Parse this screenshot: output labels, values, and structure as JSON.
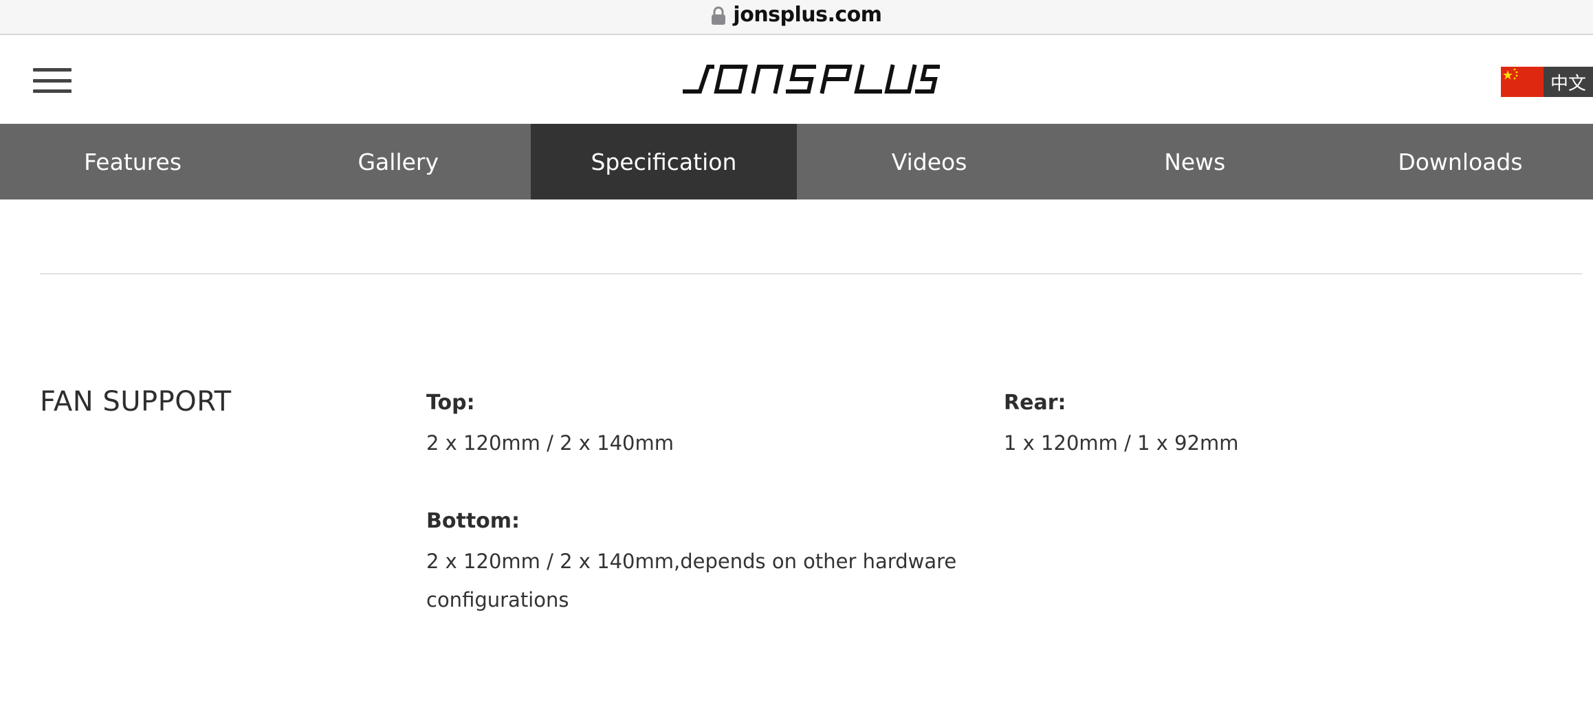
{
  "browser": {
    "url": "jonsplus.com",
    "lock_icon": "lock-icon"
  },
  "header": {
    "menu_icon": "hamburger-menu-icon",
    "logo_text": "JONSPLUS",
    "language": {
      "flag_icon": "china-flag-icon",
      "label": "中文"
    }
  },
  "nav": {
    "tabs": [
      {
        "label": "Features"
      },
      {
        "label": "Gallery"
      },
      {
        "label": "Specification",
        "active": true
      },
      {
        "label": "Videos"
      },
      {
        "label": "News"
      },
      {
        "label": "Downloads"
      }
    ]
  },
  "spec": {
    "section_title": "FAN SUPPORT",
    "top": {
      "label": "Top:",
      "value": "2 x 120mm / 2 x 140mm"
    },
    "rear": {
      "label": "Rear:",
      "value": "1 x 120mm / 1 x 92mm"
    },
    "bottom": {
      "label": "Bottom:",
      "value_line1": "2 x 120mm / 2 x 140mm,depends on other hardware",
      "value_line2": "configurations"
    }
  },
  "colors": {
    "nav_bg": "#666666",
    "nav_active_bg": "#333333",
    "flag_red": "#de2910",
    "flag_yellow": "#ffde00"
  }
}
